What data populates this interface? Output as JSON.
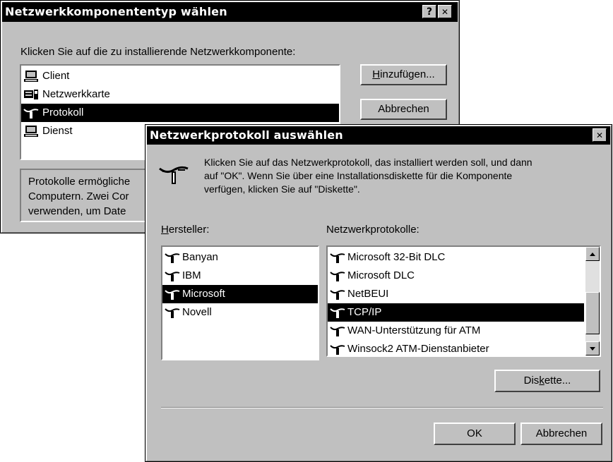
{
  "dialog1": {
    "title": "Netzwerkkomponententyp wählen",
    "help_btn": "?",
    "close_btn": "✕",
    "prompt": "Klicken Sie auf die zu installierende Netzwerkkomponente:",
    "items": [
      {
        "label": "Client",
        "icon": "computer-icon"
      },
      {
        "label": "Netzwerkkarte",
        "icon": "network-card-icon"
      },
      {
        "label": "Protokoll",
        "icon": "protocol-icon",
        "selected": true
      },
      {
        "label": "Dienst",
        "icon": "service-icon"
      }
    ],
    "add_prefix": "H",
    "add_rest": "inzufügen...",
    "cancel": "Abbrechen",
    "desc_lines": [
      "Protokolle ermögliche",
      "Computern. Zwei Cor",
      "verwenden, um Date"
    ]
  },
  "dialog2": {
    "title": "Netzwerkprotokoll auswählen",
    "close_btn": "✕",
    "intro_lines": [
      "Klicken Sie auf das Netzwerkprotokoll, das installiert werden soll, und dann",
      "auf \"OK\". Wenn Sie über eine Installationsdiskette für die Komponente",
      "verfügen, klicken Sie auf \"Diskette\"."
    ],
    "manufacturer_label_prefix": "H",
    "manufacturer_label_rest": "ersteller:",
    "protocols_label": "Netzwerkprotokolle:",
    "manufacturers": [
      {
        "label": "Banyan"
      },
      {
        "label": "IBM"
      },
      {
        "label": "Microsoft",
        "selected": true
      },
      {
        "label": "Novell"
      }
    ],
    "protocols": [
      {
        "label": "Microsoft 32-Bit DLC"
      },
      {
        "label": "Microsoft DLC"
      },
      {
        "label": "NetBEUI"
      },
      {
        "label": "TCP/IP",
        "selected": true
      },
      {
        "label": "WAN-Unterstützung für ATM"
      },
      {
        "label": "Winsock2 ATM-Dienstanbieter"
      }
    ],
    "disk_pre": "Dis",
    "disk_u": "k",
    "disk_post": "ette...",
    "ok": "OK",
    "cancel": "Abbrechen"
  }
}
